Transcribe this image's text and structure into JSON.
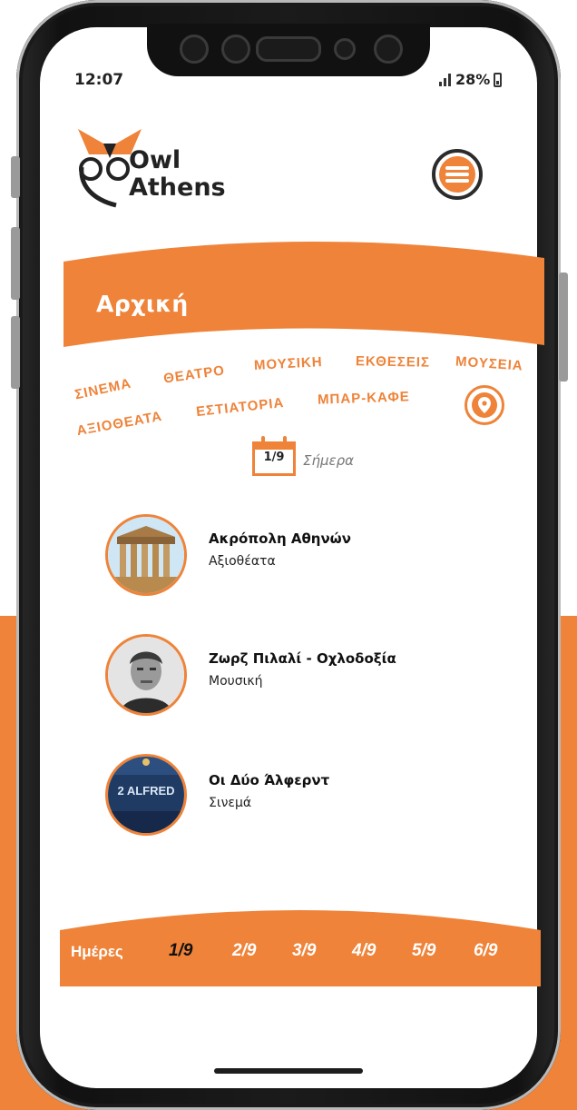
{
  "status": {
    "time": "12:07",
    "battery": "28%"
  },
  "logo": {
    "line1": "Owl",
    "line2": "Athens"
  },
  "header": {
    "title": "Αρχική"
  },
  "categories": [
    "ΣΙΝΕΜΑ",
    "ΘΕΑΤΡΟ",
    "ΜΟΥΣΙΚΗ",
    "ΕΚΘΕΣΕΙΣ",
    "ΜΟΥΣΕΙΑ",
    "ΑΞΙΟΘΕΑΤΑ",
    "ΕΣΤΙΑΤΟΡΙΑ",
    "ΜΠΑΡ-ΚΑΦΕ"
  ],
  "date_selector": {
    "date": "1/9",
    "label": "Σήμερα"
  },
  "events": [
    {
      "title": "Ακρόπολη Αθηνών",
      "category": "Αξιοθέατα"
    },
    {
      "title": "Ζωρζ Πιλαλί - Οχλοδοξία",
      "category": "Μουσική"
    },
    {
      "title": "Οι Δύο Άλφερντ",
      "category": "Σινεμά",
      "poster_text": "2 ALFRED"
    }
  ],
  "days_bar": {
    "label": "Ημέρες",
    "days": [
      "1/9",
      "2/9",
      "3/9",
      "4/9",
      "5/9",
      "6/9"
    ],
    "active": "1/9"
  },
  "colors": {
    "accent": "#ee8339",
    "dark": "#1d1d1d"
  }
}
